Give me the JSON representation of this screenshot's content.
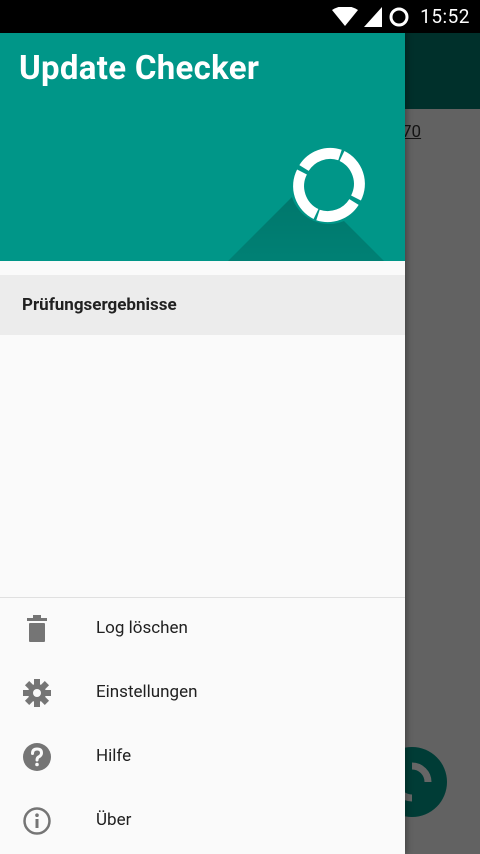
{
  "status_bar": {
    "time": "15:52"
  },
  "drawer": {
    "title": "Update Checker",
    "selected_item": "Prüfungsergebnisse",
    "menu": [
      {
        "label": "Log löschen",
        "icon": "trash-icon"
      },
      {
        "label": "Einstellungen",
        "icon": "gear-icon"
      },
      {
        "label": "Hilfe",
        "icon": "help-icon"
      },
      {
        "label": "Über",
        "icon": "info-icon"
      }
    ]
  },
  "background": {
    "link_fragment": "70"
  },
  "colors": {
    "primary": "#009688",
    "primary_dark": "#00796b",
    "icon": "#757575"
  }
}
